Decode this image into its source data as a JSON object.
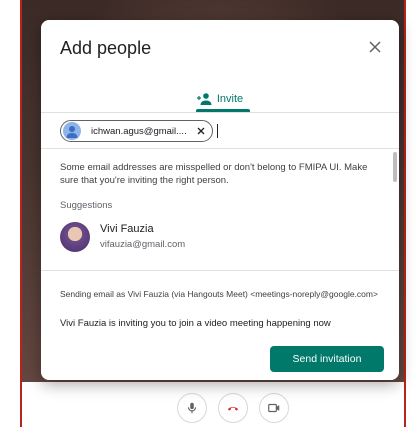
{
  "dialog": {
    "title": "Add people",
    "close_icon": "close-icon",
    "tab_label": "Invite",
    "tab_icon": "person-add-icon"
  },
  "recipient_chip": {
    "text": "ichwan.agus@gmail....",
    "remove_icon": "close-icon"
  },
  "warning": "Some email addresses are misspelled or don't belong to FMIPA UI. Make sure that you're inviting the right person.",
  "suggestions": {
    "label": "Suggestions",
    "items": [
      {
        "name": "Vivi Fauzia",
        "email": "vifauzia@gmail.com"
      }
    ]
  },
  "sending_note": "Sending email as Vivi Fauzia (via Hangouts Meet) <meetings-noreply@google.com>",
  "invite_message": "Vivi Fauzia is inviting you to join a video meeting happening now",
  "send_button": "Send invitation",
  "call_controls": [
    "microphone-icon",
    "hang-up-icon",
    "camera-icon"
  ],
  "colors": {
    "accent": "#00796b",
    "frame_border": "#b8231b",
    "hangup": "#d93025"
  }
}
